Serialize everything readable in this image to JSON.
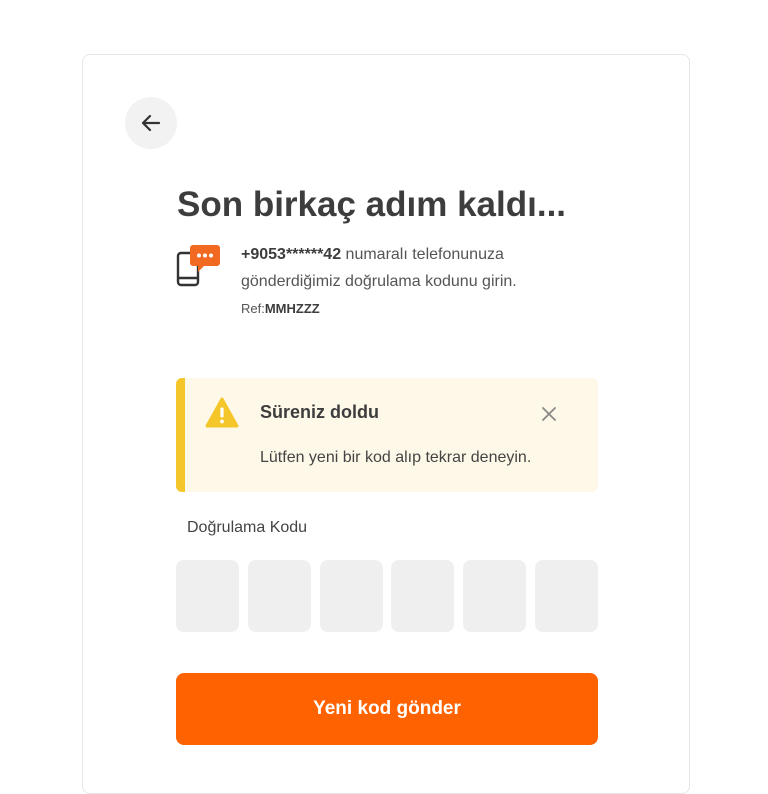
{
  "header": {
    "title": "Son birkaç adım kaldı..."
  },
  "info": {
    "phone": "+9053******42",
    "line1_rest": " numaralı telefonunuza",
    "line2": "gönderdiğimiz doğrulama kodunu girin.",
    "ref_label": "Ref:",
    "ref_value": "MMHZZZ"
  },
  "alert": {
    "title": "Süreniz doldu",
    "message": "Lütfen yeni bir kod alıp tekrar deneyin.",
    "accent_color": "#f5c62a",
    "background_color": "#fef8e8"
  },
  "code": {
    "label": "Doğrulama Kodu",
    "digits": [
      "",
      "",
      "",
      "",
      "",
      ""
    ]
  },
  "actions": {
    "resend_label": "Yeni kod gönder",
    "resend_color": "#ff6200"
  },
  "icons": {
    "back": "arrow-left-icon",
    "phone": "phone-message-icon",
    "warning": "warning-triangle-icon",
    "close": "close-icon"
  }
}
